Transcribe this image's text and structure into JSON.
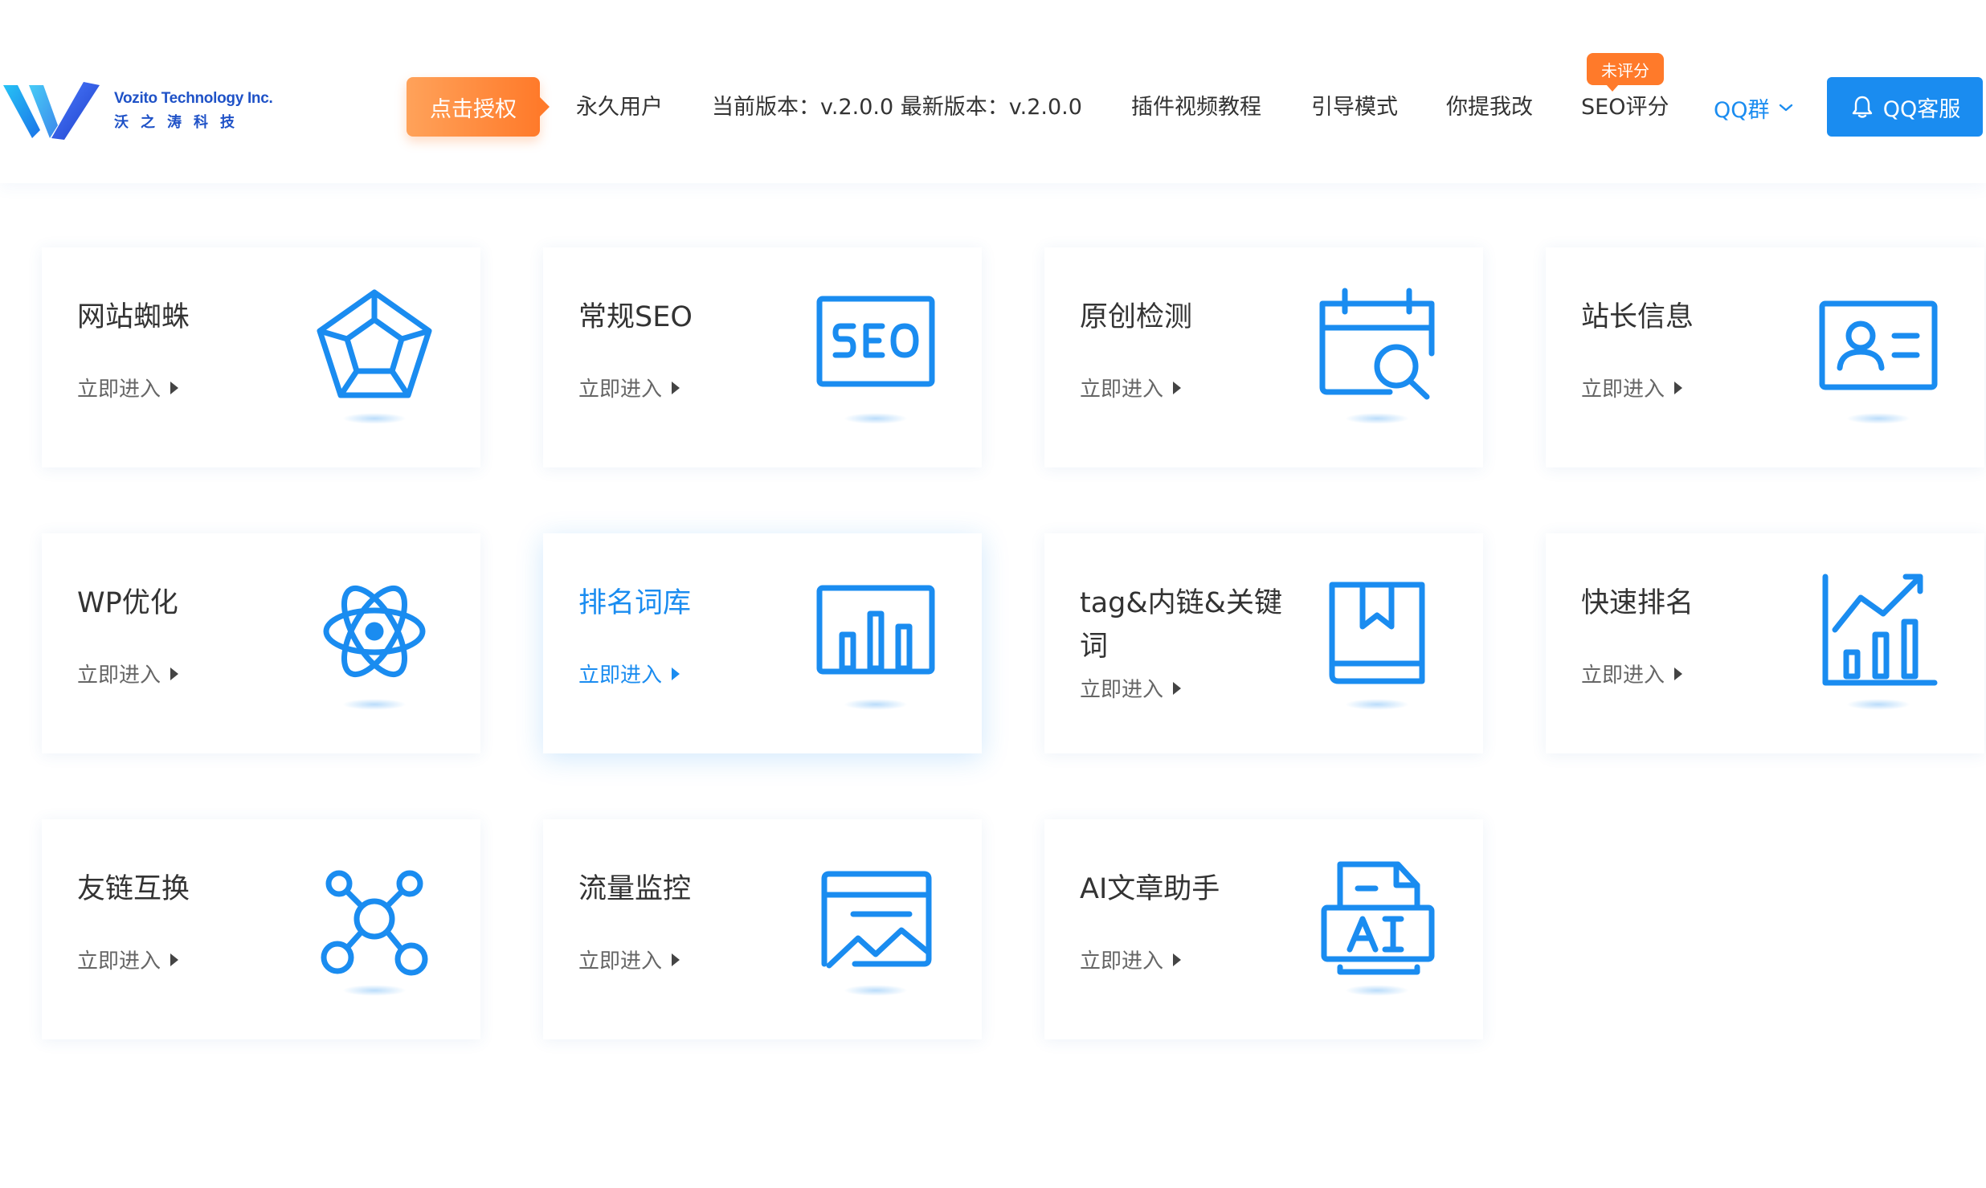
{
  "brand": {
    "name_en": "Vozito Technology Inc.",
    "name_cn": "沃之涛科技",
    "primary_color": "#1a8cf0",
    "accent_color": "#ff7a2a"
  },
  "header": {
    "auth_button": "点击授权",
    "nav": {
      "permanent_user": "永久用户",
      "version_info": "当前版本：v.2.0.0  最新版本：v.2.0.0",
      "video_tutorial": "插件视频教程",
      "guide_mode": "引导模式",
      "feedback": "你提我改",
      "seo_score": "SEO评分",
      "seo_score_badge": "未评分",
      "qq_group": "QQ群"
    },
    "qq_service_button": "QQ客服"
  },
  "cards": [
    {
      "title": "网站蜘蛛",
      "link": "立即进入",
      "icon": "pentagon-web-icon"
    },
    {
      "title": "常规SEO",
      "link": "立即进入",
      "icon": "seo-board-icon"
    },
    {
      "title": "原创检测",
      "link": "立即进入",
      "icon": "calendar-search-icon"
    },
    {
      "title": "站长信息",
      "link": "立即进入",
      "icon": "id-card-icon"
    },
    {
      "title": "WP优化",
      "link": "立即进入",
      "icon": "atom-icon"
    },
    {
      "title": "排名词库",
      "link": "立即进入",
      "icon": "bar-chart-icon",
      "active": true
    },
    {
      "title": "tag&内链&关键词",
      "link": "立即进入",
      "icon": "bookmark-book-icon"
    },
    {
      "title": "快速排名",
      "link": "立即进入",
      "icon": "growth-chart-icon"
    },
    {
      "title": "友链互换",
      "link": "立即进入",
      "icon": "network-nodes-icon"
    },
    {
      "title": "流量监控",
      "link": "立即进入",
      "icon": "image-window-icon"
    },
    {
      "title": "AI文章助手",
      "link": "立即进入",
      "icon": "ai-document-icon"
    }
  ]
}
